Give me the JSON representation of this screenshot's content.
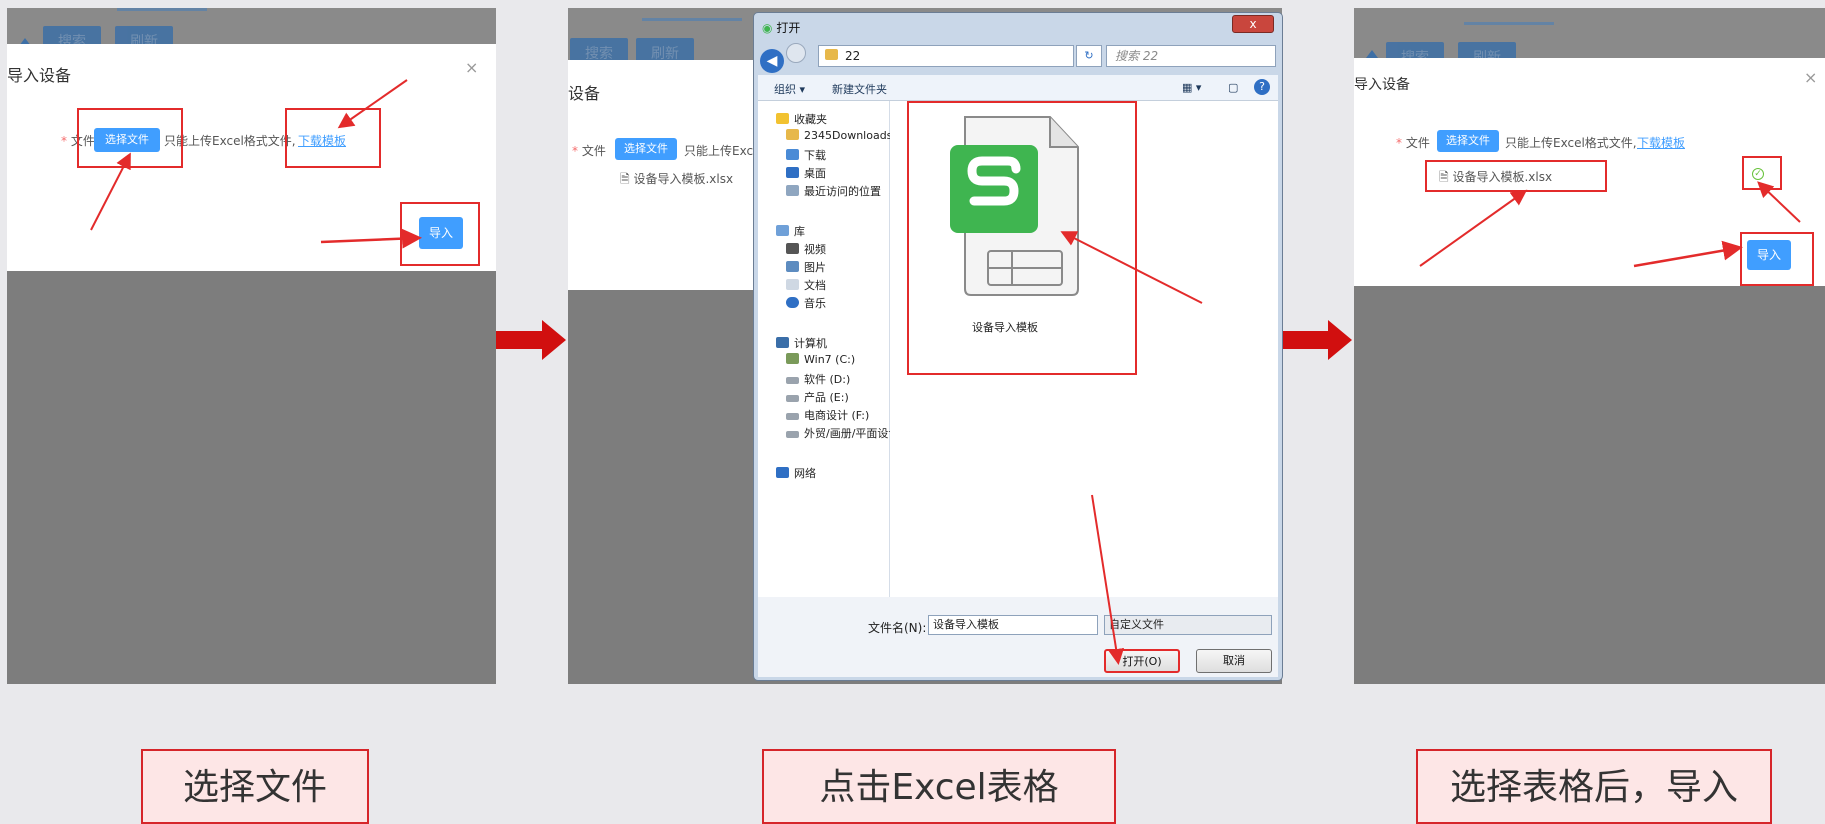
{
  "step1": {
    "bg_buttons": [
      "搜索",
      "刷新"
    ],
    "title": "导入设备",
    "close": "×",
    "field_label": "文件",
    "required_mark": "*",
    "choose_button": "选择文件",
    "hint": "只能上传Excel格式文件,",
    "download_link": "下载模板",
    "import_button": "导入",
    "caption": "选择文件"
  },
  "step2": {
    "bg_buttons": [
      "搜索",
      "刷新"
    ],
    "title": "设备",
    "field_label": "文件",
    "required_mark": "*",
    "choose_button": "选择文件",
    "hint": "只能上传Exc",
    "file_name": "设备导入模板.xlsx",
    "dialog": {
      "title": "打开",
      "close": "x",
      "address": "22",
      "search_placeholder": "搜索 22",
      "toolbar": [
        "组织 ▾",
        "新建文件夹"
      ],
      "nav": {
        "favorites": "收藏夹",
        "fav_items": [
          "2345Downloads",
          "下载",
          "桌面",
          "最近访问的位置"
        ],
        "library": "库",
        "lib_items": [
          "视频",
          "图片",
          "文档",
          "音乐"
        ],
        "computer": "计算机",
        "drives": [
          "Win7 (C:)",
          "软件 (D:)",
          "产品 (E:)",
          "电商设计 (F:)",
          "外贸/画册/平面设计"
        ],
        "network": "网络"
      },
      "file_item_label": "设备导入模板",
      "filename_label": "文件名(N):",
      "filename_value": "设备导入模板",
      "filter_value": "自定义文件",
      "open_button": "打开(O)",
      "cancel_button": "取消"
    },
    "caption": "点击Excel表格"
  },
  "step3": {
    "bg_buttons": [
      "搜索",
      "刷新"
    ],
    "title": "导入设备",
    "close": "×",
    "field_label": "文件",
    "required_mark": "*",
    "choose_button": "选择文件",
    "hint": "只能上传Excel格式文件,",
    "download_link": "下载模板",
    "file_name": "设备导入模板.xlsx",
    "success_icon": "✓",
    "import_button": "导入",
    "caption": "选择表格后，导入"
  },
  "colors": {
    "accent_blue": "#409eff",
    "annotation_red": "#e32b2b",
    "excel_green": "#3fb550"
  }
}
